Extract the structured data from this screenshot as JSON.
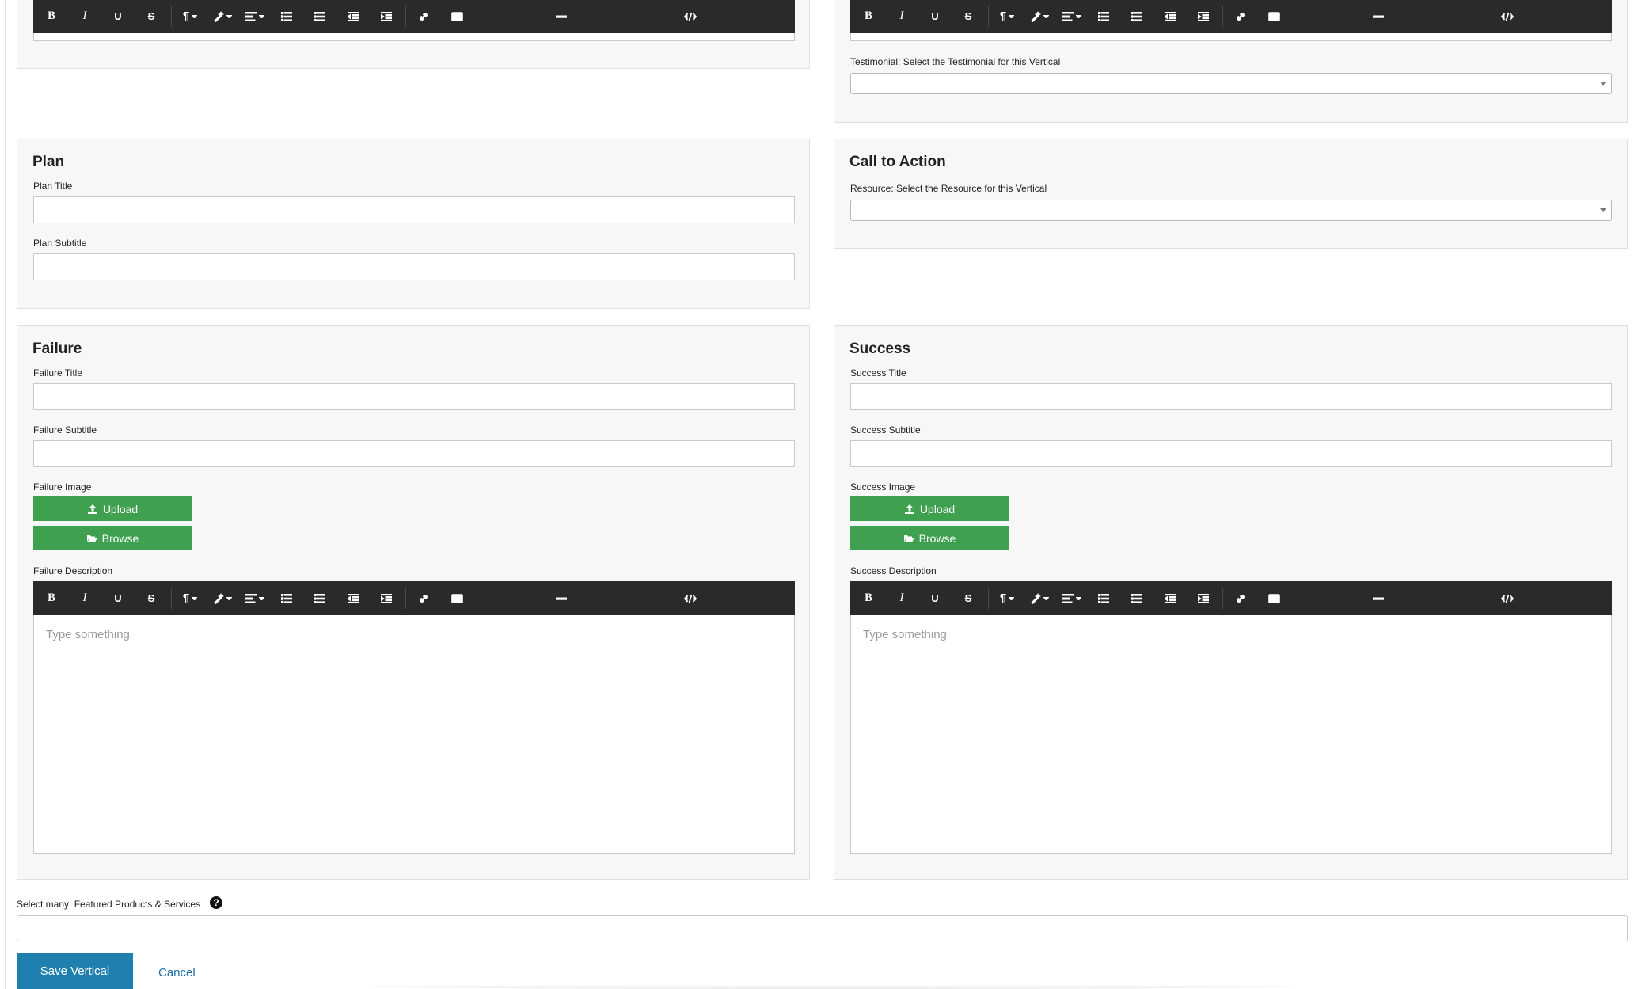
{
  "editor_toolbar": {
    "bold": "B",
    "italic": "I",
    "underline": "U",
    "strike": "S",
    "paragraph": "¶",
    "icons": [
      "bold-icon",
      "italic-icon",
      "underline-icon",
      "strikethrough-icon",
      "paragraph-icon",
      "magic-style-icon",
      "align-icon",
      "ordered-list-icon",
      "unordered-list-icon",
      "outdent-icon",
      "indent-icon",
      "link-icon",
      "image-icon",
      "horizontal-rule-icon",
      "code-view-icon"
    ]
  },
  "testimonial": {
    "label": "Testimonial: Select the Testimonial for this Vertical",
    "selected": ""
  },
  "plan": {
    "title": "Plan",
    "title_label": "Plan Title",
    "title_value": "",
    "subtitle_label": "Plan Subtitle",
    "subtitle_value": ""
  },
  "call_to_action": {
    "title": "Call to Action",
    "resource_label": "Resource: Select the Resource for this Vertical",
    "selected": ""
  },
  "failure": {
    "title": "Failure",
    "title_label": "Failure Title",
    "title_value": "",
    "subtitle_label": "Failure Subtitle",
    "subtitle_value": "",
    "image_label": "Failure Image",
    "upload_label": "Upload",
    "browse_label": "Browse",
    "description_label": "Failure Description",
    "description_placeholder": "Type something"
  },
  "success": {
    "title": "Success",
    "title_label": "Success Title",
    "title_value": "",
    "subtitle_label": "Success Subtitle",
    "subtitle_value": "",
    "image_label": "Success Image",
    "upload_label": "Upload",
    "browse_label": "Browse",
    "description_label": "Success Description",
    "description_placeholder": "Type something"
  },
  "featured": {
    "label": "Select many: Featured Products & Services",
    "help": "?",
    "value": ""
  },
  "actions": {
    "save_label": "Save Vertical",
    "cancel_label": "Cancel"
  },
  "colors": {
    "accent_green": "#3fa14f",
    "save_blue": "#1f7fae",
    "link_blue": "#1f6ea8",
    "toolbar_dark": "#2a2a2a"
  }
}
